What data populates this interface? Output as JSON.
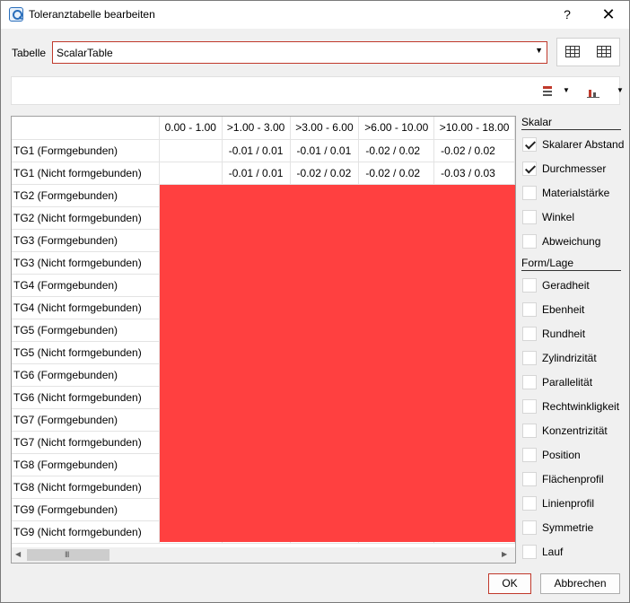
{
  "window": {
    "title": "Toleranztabelle bearbeiten",
    "help_glyph": "?",
    "close_glyph": "✕"
  },
  "header": {
    "table_label": "Tabelle",
    "table_value": "ScalarTable",
    "dropdown_glyph": "▼"
  },
  "toolbar2": {
    "dropdown_glyph": "▼"
  },
  "table": {
    "columns": [
      "",
      "0.00 - 1.00",
      ">1.00 - 3.00",
      ">3.00 - 6.00",
      ">6.00 - 10.00",
      ">10.00 - 18.00"
    ],
    "rows": [
      {
        "label": "TG1  (Formgebunden)",
        "cells": [
          "",
          "-0.01 / 0.01",
          "-0.01 / 0.01",
          "-0.02 / 0.02",
          "-0.02 / 0.02"
        ]
      },
      {
        "label": "TG1  (Nicht formgebunden)",
        "cells": [
          "",
          "-0.01 / 0.01",
          "-0.02 / 0.02",
          "-0.02 / 0.02",
          "-0.03 / 0.03"
        ]
      },
      {
        "label": "TG2  (Formgebunden)",
        "cells": [
          "",
          "",
          "",
          "",
          ""
        ]
      },
      {
        "label": "TG2  (Nicht formgebunden)",
        "cells": [
          "",
          "",
          "",
          "",
          ""
        ]
      },
      {
        "label": "TG3  (Formgebunden)",
        "cells": [
          "",
          "",
          "",
          "",
          ""
        ]
      },
      {
        "label": "TG3  (Nicht formgebunden)",
        "cells": [
          "",
          "",
          "",
          "",
          ""
        ]
      },
      {
        "label": "TG4  (Formgebunden)",
        "cells": [
          "",
          "",
          "",
          "",
          ""
        ]
      },
      {
        "label": "TG4  (Nicht formgebunden)",
        "cells": [
          "",
          "",
          "",
          "",
          ""
        ]
      },
      {
        "label": "TG5  (Formgebunden)",
        "cells": [
          "",
          "",
          "",
          "",
          ""
        ]
      },
      {
        "label": "TG5  (Nicht formgebunden)",
        "cells": [
          "",
          "",
          "",
          "",
          ""
        ]
      },
      {
        "label": "TG6  (Formgebunden)",
        "cells": [
          "",
          "",
          "",
          "",
          ""
        ]
      },
      {
        "label": "TG6  (Nicht formgebunden)",
        "cells": [
          "",
          "",
          "",
          "",
          ""
        ]
      },
      {
        "label": "TG7  (Formgebunden)",
        "cells": [
          "",
          "",
          "",
          "",
          ""
        ]
      },
      {
        "label": "TG7  (Nicht formgebunden)",
        "cells": [
          "",
          "",
          "",
          "",
          ""
        ]
      },
      {
        "label": "TG8  (Formgebunden)",
        "cells": [
          "",
          "",
          "",
          "",
          ""
        ]
      },
      {
        "label": "TG8  (Nicht formgebunden)",
        "cells": [
          "",
          "",
          "",
          "",
          ""
        ]
      },
      {
        "label": "TG9  (Formgebunden)",
        "cells": [
          "",
          "",
          "",
          "",
          ""
        ]
      },
      {
        "label": "TG9  (Nicht formgebunden)",
        "cells": [
          "",
          "",
          "",
          "",
          ""
        ]
      }
    ],
    "redaction_color": "#ff4040",
    "scroll": {
      "left_glyph": "◀",
      "right_glyph": "▶",
      "grip_glyph": "III"
    }
  },
  "sidebar": {
    "sections": [
      {
        "title": "Skalar",
        "items": [
          {
            "label": "Skalarer Abstand",
            "checked": true
          },
          {
            "label": "Durchmesser",
            "checked": true
          },
          {
            "label": "Materialstärke",
            "checked": false
          },
          {
            "label": "Winkel",
            "checked": false
          },
          {
            "label": "Abweichung",
            "checked": false
          }
        ]
      },
      {
        "title": "Form/Lage",
        "items": [
          {
            "label": "Geradheit",
            "checked": false
          },
          {
            "label": "Ebenheit",
            "checked": false
          },
          {
            "label": "Rundheit",
            "checked": false
          },
          {
            "label": "Zylindrizität",
            "checked": false
          },
          {
            "label": "Parallelität",
            "checked": false
          },
          {
            "label": "Rechtwinkligkeit",
            "checked": false
          },
          {
            "label": "Konzentrizität",
            "checked": false
          },
          {
            "label": "Position",
            "checked": false
          },
          {
            "label": "Flächenprofil",
            "checked": false
          },
          {
            "label": "Linienprofil",
            "checked": false
          },
          {
            "label": "Symmetrie",
            "checked": false
          },
          {
            "label": "Lauf",
            "checked": false
          }
        ]
      }
    ]
  },
  "footer": {
    "ok_label": "OK",
    "cancel_label": "Abbrechen"
  },
  "colors": {
    "accent_border": "#c0392b"
  }
}
